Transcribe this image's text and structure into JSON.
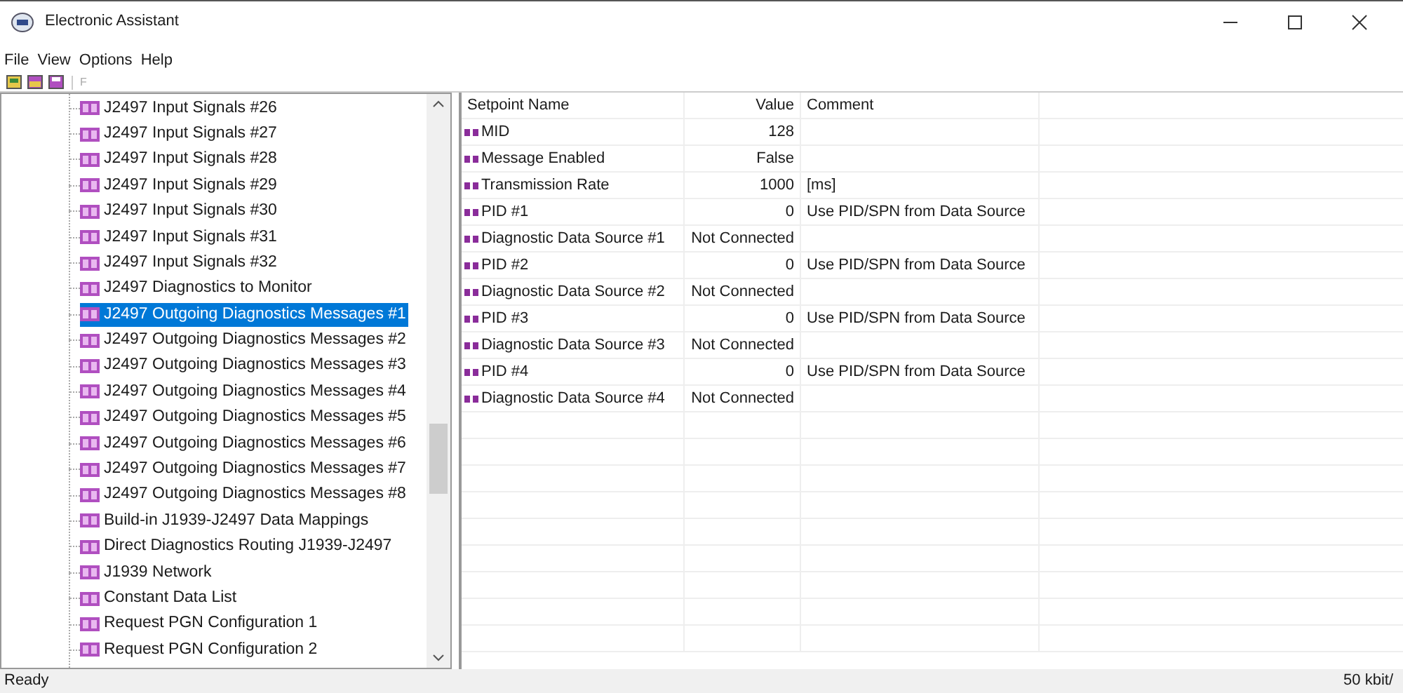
{
  "window": {
    "title": "Electronic Assistant"
  },
  "menu": [
    "File",
    "View",
    "Options",
    "Help"
  ],
  "toolbar": {
    "disabled_label": "F"
  },
  "tree": {
    "items": [
      {
        "label": "J2497 Input Signals #26",
        "selected": false
      },
      {
        "label": "J2497 Input Signals #27",
        "selected": false
      },
      {
        "label": "J2497 Input Signals #28",
        "selected": false
      },
      {
        "label": "J2497 Input Signals #29",
        "selected": false
      },
      {
        "label": "J2497 Input Signals #30",
        "selected": false
      },
      {
        "label": "J2497 Input Signals #31",
        "selected": false
      },
      {
        "label": "J2497 Input Signals #32",
        "selected": false
      },
      {
        "label": "J2497 Diagnostics to Monitor",
        "selected": false
      },
      {
        "label": "J2497 Outgoing Diagnostics Messages #1",
        "selected": true
      },
      {
        "label": "J2497 Outgoing Diagnostics Messages #2",
        "selected": false
      },
      {
        "label": "J2497 Outgoing Diagnostics Messages #3",
        "selected": false
      },
      {
        "label": "J2497 Outgoing Diagnostics Messages #4",
        "selected": false
      },
      {
        "label": "J2497 Outgoing Diagnostics Messages #5",
        "selected": false
      },
      {
        "label": "J2497 Outgoing Diagnostics Messages #6",
        "selected": false
      },
      {
        "label": "J2497 Outgoing Diagnostics Messages #7",
        "selected": false
      },
      {
        "label": "J2497 Outgoing Diagnostics Messages #8",
        "selected": false
      },
      {
        "label": "Build-in J1939-J2497 Data Mappings",
        "selected": false
      },
      {
        "label": "Direct Diagnostics Routing J1939-J2497",
        "selected": false
      },
      {
        "label": "J1939 Network",
        "selected": false
      },
      {
        "label": "Constant Data List",
        "selected": false
      },
      {
        "label": "Request PGN Configuration 1",
        "selected": false
      },
      {
        "label": "Request PGN Configuration 2",
        "selected": false
      }
    ]
  },
  "table": {
    "columns": [
      "Setpoint Name",
      "Value",
      "Comment"
    ],
    "rows": [
      {
        "name": "MID",
        "value": "128",
        "comment": ""
      },
      {
        "name": "Message Enabled",
        "value": "False",
        "comment": ""
      },
      {
        "name": "Transmission Rate",
        "value": "1000",
        "comment": "[ms]"
      },
      {
        "name": "PID #1",
        "value": "0",
        "comment": "Use PID/SPN from Data Source"
      },
      {
        "name": "Diagnostic Data Source #1",
        "value": "Not Connected",
        "comment": ""
      },
      {
        "name": "PID #2",
        "value": "0",
        "comment": "Use PID/SPN from Data Source"
      },
      {
        "name": "Diagnostic Data Source #2",
        "value": "Not Connected",
        "comment": ""
      },
      {
        "name": "PID #3",
        "value": "0",
        "comment": "Use PID/SPN from Data Source"
      },
      {
        "name": "Diagnostic Data Source #3",
        "value": "Not Connected",
        "comment": ""
      },
      {
        "name": "PID #4",
        "value": "0",
        "comment": "Use PID/SPN from Data Source"
      },
      {
        "name": "Diagnostic Data Source #4",
        "value": "Not Connected",
        "comment": ""
      }
    ]
  },
  "status_bar": {
    "left": "Ready",
    "right": "50 kbit/"
  }
}
